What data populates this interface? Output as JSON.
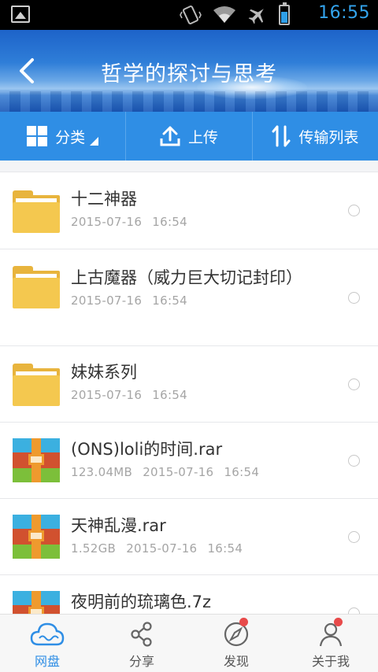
{
  "status_bar": {
    "time": "16:55",
    "icons": [
      "image-notification-icon",
      "vibrate-icon",
      "wifi-icon",
      "airplane-mode-icon",
      "battery-icon"
    ]
  },
  "header": {
    "title": "哲学的探讨与思考",
    "back_icon": "back-arrow-icon"
  },
  "toolbar": {
    "category_label": "分类",
    "upload_label": "上传",
    "transfer_label": "传输列表"
  },
  "files": [
    {
      "type": "folder",
      "name": "十二神器",
      "size": "",
      "date": "2015-07-16",
      "time": "16:54"
    },
    {
      "type": "folder",
      "name": "上古魔器（威力巨大切记封印）",
      "size": "",
      "date": "2015-07-16",
      "time": "16:54"
    },
    {
      "type": "folder",
      "name": "妹妹系列",
      "size": "",
      "date": "2015-07-16",
      "time": "16:54"
    },
    {
      "type": "archive",
      "name": "(ONS)loli的时间.rar",
      "size": "123.04MB",
      "date": "2015-07-16",
      "time": "16:54"
    },
    {
      "type": "archive",
      "name": "天神乱漫.rar",
      "size": "1.52GB",
      "date": "2015-07-16",
      "time": "16:54"
    },
    {
      "type": "archive",
      "name": "夜明前的琉璃色.7z",
      "size": "",
      "date": "",
      "time": ""
    }
  ],
  "bottom_nav": [
    {
      "label": "网盘",
      "icon": "cloud-icon",
      "active": true,
      "badge": false
    },
    {
      "label": "分享",
      "icon": "share-icon",
      "active": false,
      "badge": false
    },
    {
      "label": "发现",
      "icon": "compass-icon",
      "active": false,
      "badge": true
    },
    {
      "label": "关于我",
      "icon": "person-icon",
      "active": false,
      "badge": true
    }
  ],
  "colors": {
    "accent": "#2f8ee5",
    "status_time": "#33a4ee",
    "badge": "#e84a4a",
    "folder": "#f4c84f"
  }
}
